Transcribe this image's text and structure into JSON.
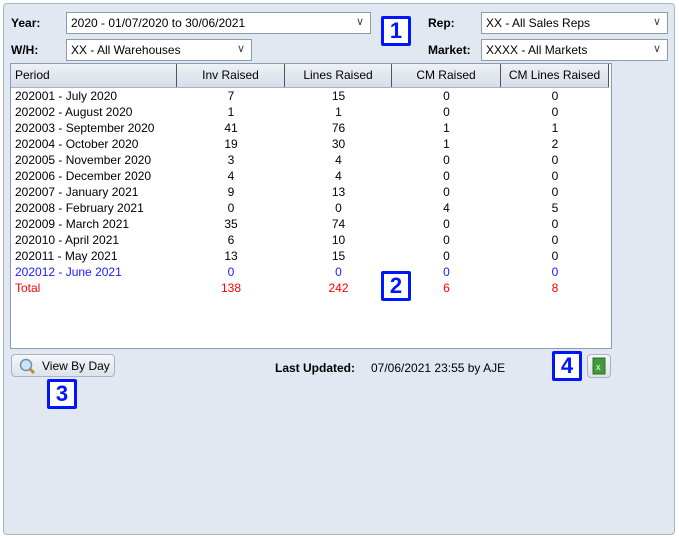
{
  "filters": {
    "year_label": "Year:",
    "year_value": "2020 - 01/07/2020 to 30/06/2021",
    "wh_label": "W/H:",
    "wh_value": "XX - All Warehouses",
    "rep_label": "Rep:",
    "rep_value": "XX - All Sales Reps",
    "market_label": "Market:",
    "market_value": "XXXX - All Markets"
  },
  "markers": [
    "1",
    "2",
    "3",
    "4"
  ],
  "table": {
    "columns": [
      "Period",
      "Inv Raised",
      "Lines Raised",
      "CM Raised",
      "CM Lines Raised"
    ],
    "rows": [
      [
        "202001 - July 2020",
        "7",
        "15",
        "0",
        "0"
      ],
      [
        "202002 - August 2020",
        "1",
        "1",
        "0",
        "0"
      ],
      [
        "202003 - September 2020",
        "41",
        "76",
        "1",
        "1"
      ],
      [
        "202004 - October 2020",
        "19",
        "30",
        "1",
        "2"
      ],
      [
        "202005 - November 2020",
        "3",
        "4",
        "0",
        "0"
      ],
      [
        "202006 - December 2020",
        "4",
        "4",
        "0",
        "0"
      ],
      [
        "202007 - January 2021",
        "9",
        "13",
        "0",
        "0"
      ],
      [
        "202008 - February 2021",
        "0",
        "0",
        "4",
        "5"
      ],
      [
        "202009 - March 2021",
        "35",
        "74",
        "0",
        "0"
      ],
      [
        "202010 - April 2021",
        "6",
        "10",
        "0",
        "0"
      ],
      [
        "202011 - May 2021",
        "13",
        "15",
        "0",
        "0"
      ],
      [
        "202012 - June 2021",
        "0",
        "0",
        "0",
        "0"
      ],
      [
        "Total",
        "138",
        "242",
        "6",
        "8"
      ]
    ],
    "current_row_color": "#1a1aff",
    "total_color": "#ff0000"
  },
  "footer": {
    "view_by_day": "View By Day",
    "last_updated_label": "Last Updated:",
    "last_updated_value": "07/06/2021 23:55 by AJE"
  }
}
